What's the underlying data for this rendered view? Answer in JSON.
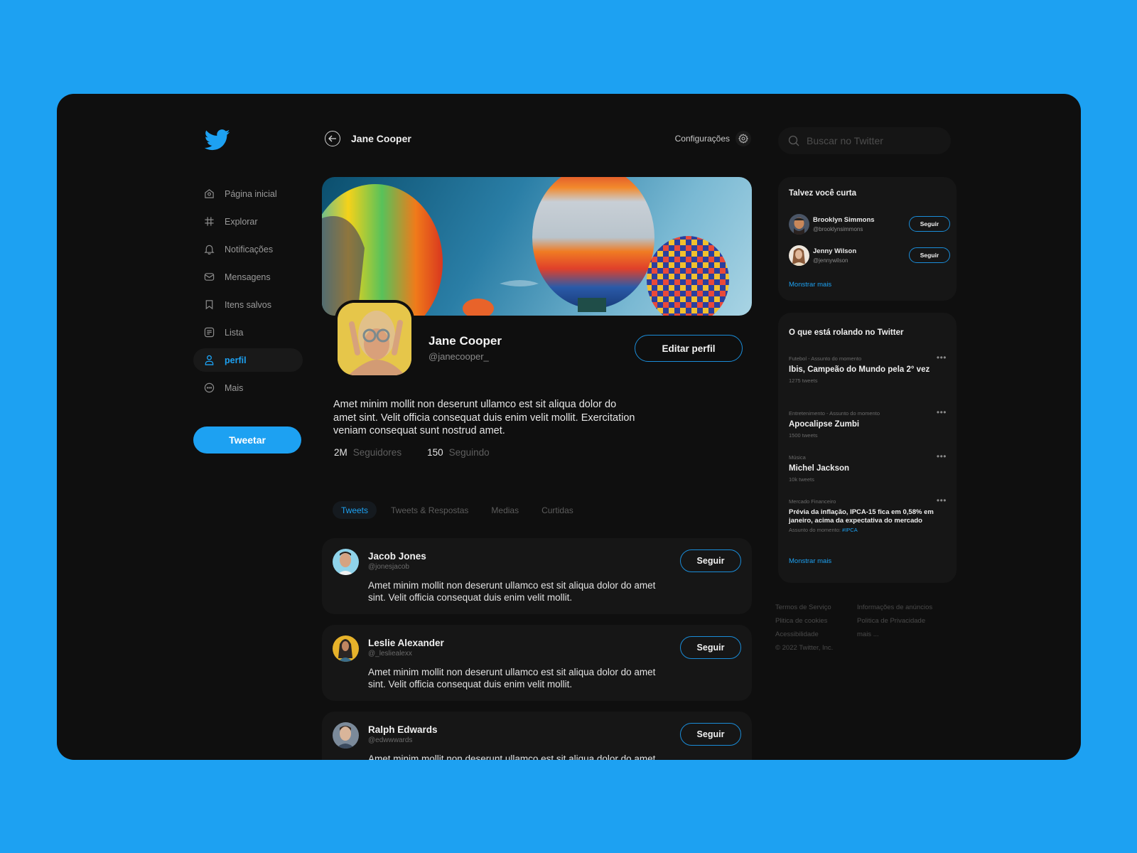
{
  "colors": {
    "brand": "#1da1f2",
    "background": "#0f0f0f",
    "card": "#161616"
  },
  "sidebar": {
    "logo": "twitter-bird-icon",
    "items": [
      {
        "label": "Página inicial",
        "icon": "home-icon",
        "active": false
      },
      {
        "label": "Explorar",
        "icon": "hashtag-icon",
        "active": false
      },
      {
        "label": "Notificações",
        "icon": "bell-icon",
        "active": false
      },
      {
        "label": "Mensagens",
        "icon": "mail-icon",
        "active": false
      },
      {
        "label": "Itens salvos",
        "icon": "bookmark-icon",
        "active": false
      },
      {
        "label": "Lista",
        "icon": "list-icon",
        "active": false
      },
      {
        "label": "perfil",
        "icon": "user-icon",
        "active": true
      },
      {
        "label": "Mais",
        "icon": "more-circle-icon",
        "active": false
      }
    ],
    "tweet_button": "Tweetar"
  },
  "header": {
    "title": "Jane Cooper",
    "settings_label": "Configurações"
  },
  "profile": {
    "name": "Jane Cooper",
    "handle": "@janecooper_",
    "edit_button": "Editar perfil",
    "bio": "Amet minim mollit non deserunt ullamco est sit aliqua dolor do amet sint. Velit officia consequat duis enim velit mollit. Exercitation veniam consequat sunt nostrud amet.",
    "stats": [
      {
        "value": "2M",
        "label": "Seguidores"
      },
      {
        "value": "150",
        "label": "Seguindo"
      }
    ]
  },
  "tabs": [
    {
      "label": "Tweets",
      "active": true
    },
    {
      "label": "Tweets & Respostas",
      "active": false
    },
    {
      "label": "Medias",
      "active": false
    },
    {
      "label": "Curtidas",
      "active": false
    }
  ],
  "tweets": [
    {
      "name": "Jacob Jones",
      "handle": "@jonesjacob",
      "text": "Amet minim mollit non deserunt ullamco est sit aliqua dolor do amet sint. Velit officia consequat duis enim velit mollit.",
      "follow": "Seguir"
    },
    {
      "name": "Leslie Alexander",
      "handle": "@_lesliealexx",
      "text": "Amet minim mollit non deserunt ullamco est sit aliqua dolor do amet sint. Velit officia consequat duis enim velit mollit.",
      "follow": "Seguir"
    },
    {
      "name": "Ralph Edwards",
      "handle": "@edwwwards",
      "text": "Amet minim mollit non deserunt ullamco est sit aliqua dolor do amet sint. Velit officia consequat duis enim velit mollit.",
      "follow": "Seguir"
    }
  ],
  "search": {
    "placeholder": "Buscar no Twitter"
  },
  "suggestions": {
    "title": "Talvez você curta",
    "users": [
      {
        "name": "Brooklyn Simmons",
        "handle": "@brooklynsimmons",
        "follow": "Seguir"
      },
      {
        "name": "Jenny Wilson",
        "handle": "@jennywilson",
        "follow": "Seguir"
      }
    ],
    "more": "Monstrar mais"
  },
  "trends": {
    "title": "O que está rolando no Twitter",
    "items": [
      {
        "category": "Futebol - Assunto do momento",
        "title": "Ibis, Campeão do Mundo pela 2° vez",
        "count": "1275 tweets"
      },
      {
        "category": "Entretenimento - Assunto do momento",
        "title": "Apocalipse Zumbi",
        "count": "1500 tweets"
      },
      {
        "category": "Música",
        "title": "Michel Jackson",
        "count": "10k tweets"
      },
      {
        "category": "Mercado Financeiro",
        "title": "Prévia da inflação, IPCA-15 fica em 0,58% em janeiro, acima da expectativa do mercado",
        "count_prefix": "Assunto do momento: ",
        "tag": "#IPCA"
      }
    ],
    "more": "Monstrar mais",
    "more_dots": "•••"
  },
  "footer": {
    "links": [
      "Termos de Serviço",
      "Informações de anúncios",
      "Plitica de cookies",
      "Politica de Privacidade",
      "Acessibilidade",
      "mais ..."
    ],
    "copyright": "© 2022 Twitter, Inc."
  }
}
